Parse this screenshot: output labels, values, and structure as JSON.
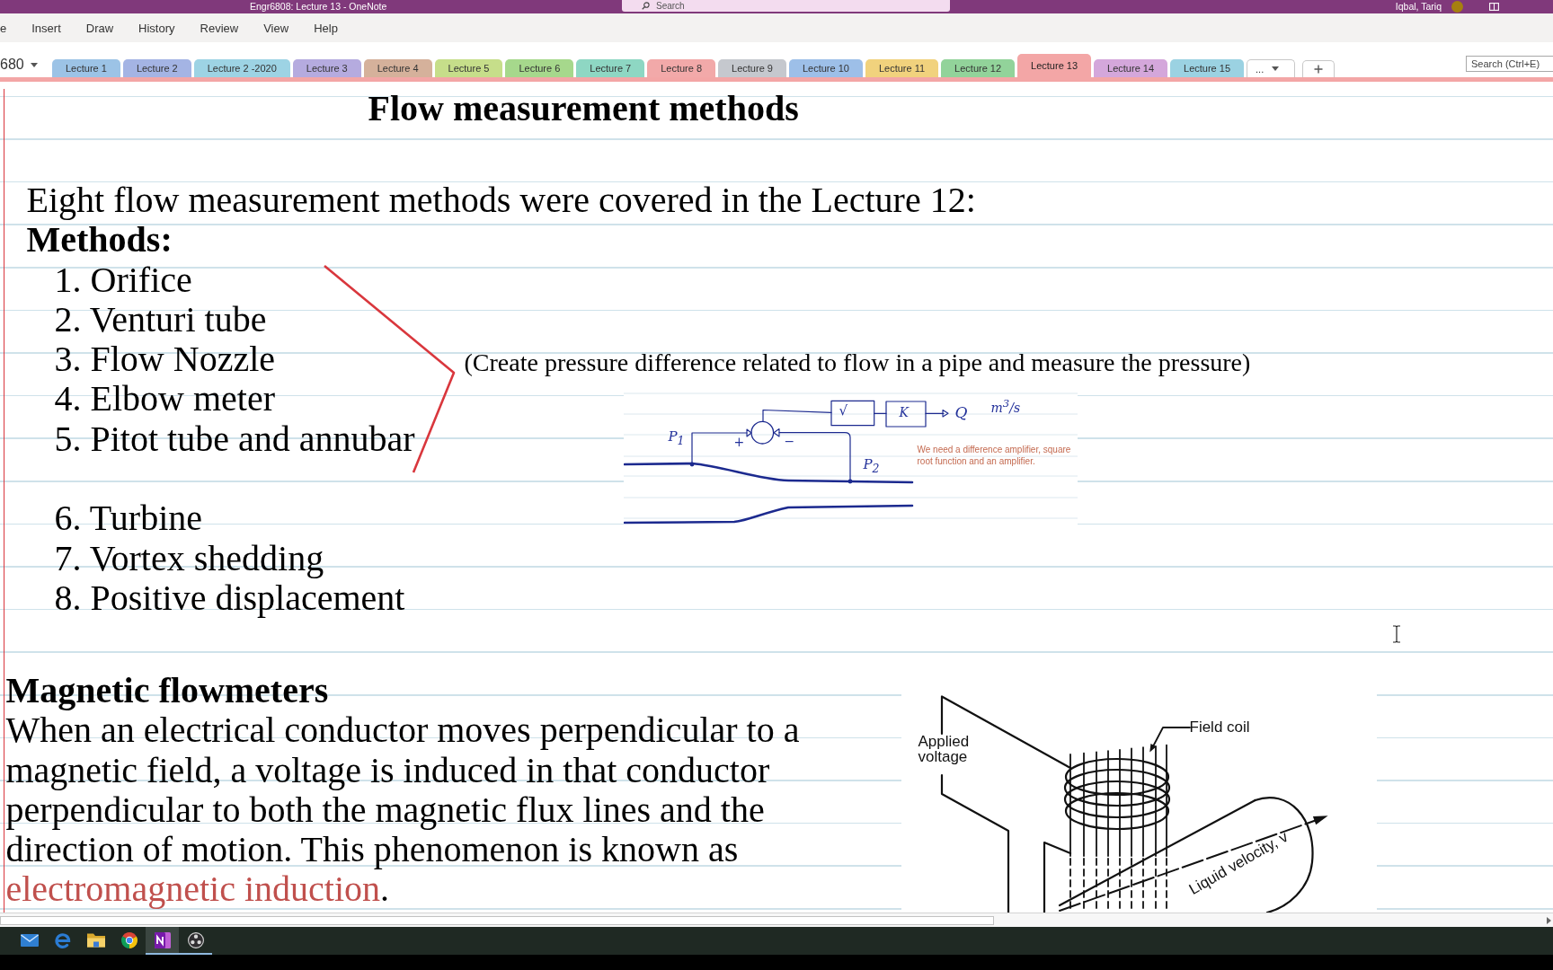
{
  "window": {
    "title": "Engr6808: Lecture 13 - OneNote",
    "search_placeholder": "Search",
    "user_name": "Iqbal, Tariq"
  },
  "menu": [
    "e",
    "Insert",
    "Draw",
    "History",
    "Review",
    "View",
    "Help"
  ],
  "notebook": {
    "name": "680"
  },
  "section_tabs": [
    {
      "label": "Lecture 1",
      "color": "#9cc3e6",
      "selected": false
    },
    {
      "label": "Lecture 2",
      "color": "#a4b4e4",
      "selected": false
    },
    {
      "label": "Lecture 2 -2020",
      "color": "#9dd3e4",
      "selected": false
    },
    {
      "label": "Lecture 3",
      "color": "#b5abdf",
      "selected": false
    },
    {
      "label": "Lecture 4",
      "color": "#d5b19b",
      "selected": false
    },
    {
      "label": "Lecture 5",
      "color": "#c6de8a",
      "selected": false
    },
    {
      "label": "Lecture 6",
      "color": "#a6d88c",
      "selected": false
    },
    {
      "label": "Lecture 7",
      "color": "#8ed7c3",
      "selected": false
    },
    {
      "label": "Lecture 8",
      "color": "#f2a9a9",
      "selected": false
    },
    {
      "label": "Lecture 9",
      "color": "#c5c8ce",
      "selected": false
    },
    {
      "label": "Lecture 10",
      "color": "#9dbfe8",
      "selected": false
    },
    {
      "label": "Lecture 11",
      "color": "#f1d27d",
      "selected": false
    },
    {
      "label": "Lecture 12",
      "color": "#92d39a",
      "selected": false
    },
    {
      "label": "Lecture 13",
      "color": "#f3a6a6",
      "selected": true
    },
    {
      "label": "Lecture 14",
      "color": "#d4a7db",
      "selected": false
    },
    {
      "label": "Lecture 15",
      "color": "#9bd2e2",
      "selected": false
    }
  ],
  "more_sections_label": "...",
  "search": {
    "placeholder": "Search (Ctrl+E)"
  },
  "page": {
    "title": "Flow measurement methods",
    "intro": "Eight flow measurement methods were covered in the Lecture 12:",
    "methods": {
      "heading": "Methods:",
      "groups": [
        {
          "items": [
            "1. Orifice",
            "2. Venturi tube",
            "3. Flow Nozzle",
            "4. Elbow meter",
            "5. Pitot tube and annubar"
          ],
          "note": "(Create pressure difference related to flow in a pipe and measure the pressure)"
        },
        {
          "items": [
            "6. Turbine",
            "7. Vortex shedding",
            "8. Positive displacement"
          ]
        }
      ]
    },
    "flow_sketch": {
      "labels": [
        "P$_{1}$",
        "+",
        "−",
        "P$_{2}$",
        "√",
        "K",
        "Q",
        "m$^{3}$/s"
      ],
      "caption": "We need a difference amplifier, square root function and an amplifier."
    },
    "magnetic": {
      "heading": "Magnetic flowmeters",
      "paragraph": {
        "text": "When an electrical conductor moves perpendicular to a magnetic field, a voltage is induced in that conductor perpendicular to both the magnetic flux lines and the direction of motion. This phenomenon is known as",
        "highlight": "electromagnetic induction",
        "ending": "."
      },
      "figure": {
        "labels": [
          "Applied voltage",
          "Field coil",
          "Liquid velocity, v"
        ]
      }
    }
  },
  "taskbar": {
    "apps": [
      {
        "kind": "mail",
        "active": false,
        "running": false
      },
      {
        "kind": "browser",
        "active": false,
        "running": false
      },
      {
        "kind": "files",
        "active": false,
        "running": false
      },
      {
        "kind": "web",
        "active": false,
        "running": false
      },
      {
        "kind": "notes",
        "active": true,
        "running": true
      },
      {
        "kind": "recorder",
        "active": false,
        "running": true
      }
    ]
  }
}
